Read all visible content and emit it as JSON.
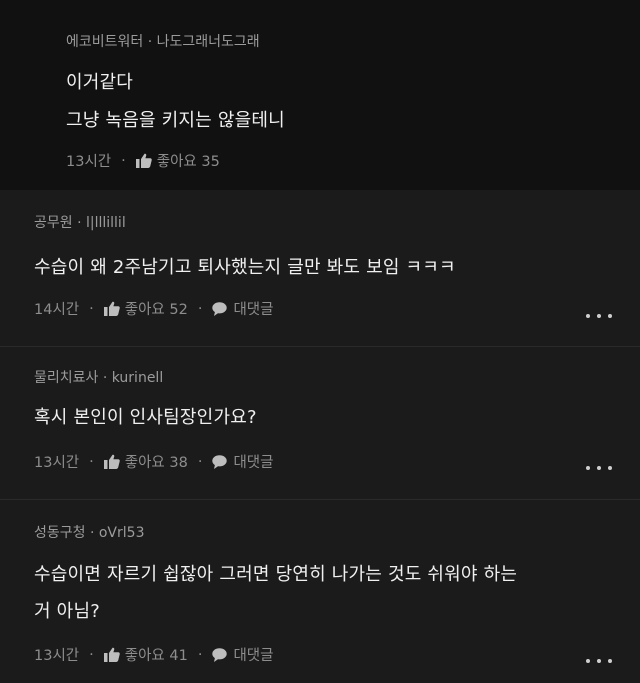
{
  "reply": {
    "author": "에코비트워터 · 나도그래너도그래",
    "lines": [
      "이거같다",
      "그냥 녹음을 키지는 않을테니"
    ],
    "time": "13시간",
    "like_label": "좋아요 35"
  },
  "comments": [
    {
      "author": "공무원 · l|lllillil",
      "lines": [
        "수습이 왜 2주남기고 퇴사했는지 글만 봐도 보임 ㅋㅋㅋ"
      ],
      "time": "14시간",
      "like_label": "좋아요 52",
      "reply_label": "대댓글"
    },
    {
      "author": "물리치료사 · kurinell",
      "lines": [
        "혹시 본인이 인사팀장인가요?"
      ],
      "time": "13시간",
      "like_label": "좋아요 38",
      "reply_label": "대댓글"
    },
    {
      "author": "성동구청 · oVrl53",
      "lines": [
        "수습이면 자르기 쉽잖아 그러면 당연히 나가는 것도 쉬워야 하는",
        "거 아님?"
      ],
      "time": "13시간",
      "like_label": "좋아요 41",
      "reply_label": "대댓글"
    }
  ],
  "separator": "·",
  "icons": {
    "like": "thumbs-up-icon",
    "reply": "speech-bubble-icon",
    "more": "more-dots-icon"
  },
  "colors": {
    "background": "#1b1b1b",
    "reply_background": "#111111",
    "primary_text": "#f0f0f0",
    "secondary_text": "#8d8d8d"
  }
}
